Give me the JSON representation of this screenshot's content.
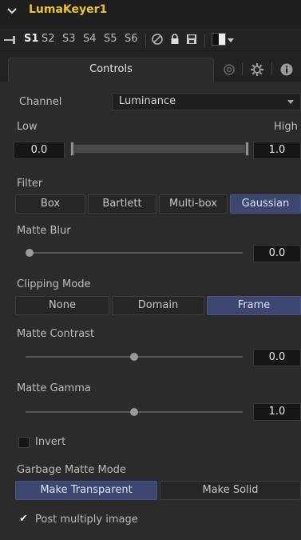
{
  "tool": {
    "name": "LumaKeyer1"
  },
  "versions": {
    "items": [
      "S1",
      "S2",
      "S3",
      "S4",
      "S5",
      "S6"
    ],
    "active": "S1"
  },
  "tabs": {
    "controls_label": "Controls"
  },
  "channel": {
    "label": "Channel",
    "value": "Luminance"
  },
  "range": {
    "low_label": "Low",
    "high_label": "High",
    "low_value": "0.0",
    "high_value": "1.0"
  },
  "filter": {
    "label": "Filter",
    "options": [
      "Box",
      "Bartlett",
      "Multi-box",
      "Gaussian"
    ],
    "selected": "Gaussian"
  },
  "matte_blur": {
    "label": "Matte Blur",
    "value": "0.0",
    "level": 0.0
  },
  "clipping_mode": {
    "label": "Clipping Mode",
    "options": [
      "None",
      "Domain",
      "Frame"
    ],
    "selected": "Frame"
  },
  "matte_contrast": {
    "label": "Matte Contrast",
    "value": "0.0",
    "level": 0.5
  },
  "matte_gamma": {
    "label": "Matte Gamma",
    "value": "1.0",
    "level": 0.5
  },
  "invert": {
    "label": "Invert",
    "checked": false
  },
  "garbage_matte_mode": {
    "label": "Garbage Matte Mode",
    "options": [
      "Make Transparent",
      "Make Solid"
    ],
    "selected": "Make Transparent"
  },
  "post_multiply": {
    "label": "Post multiply image",
    "checked": true
  },
  "colors": {
    "accent": "#3d466e",
    "title": "#e8c52a",
    "background": "#2b2b2b"
  }
}
